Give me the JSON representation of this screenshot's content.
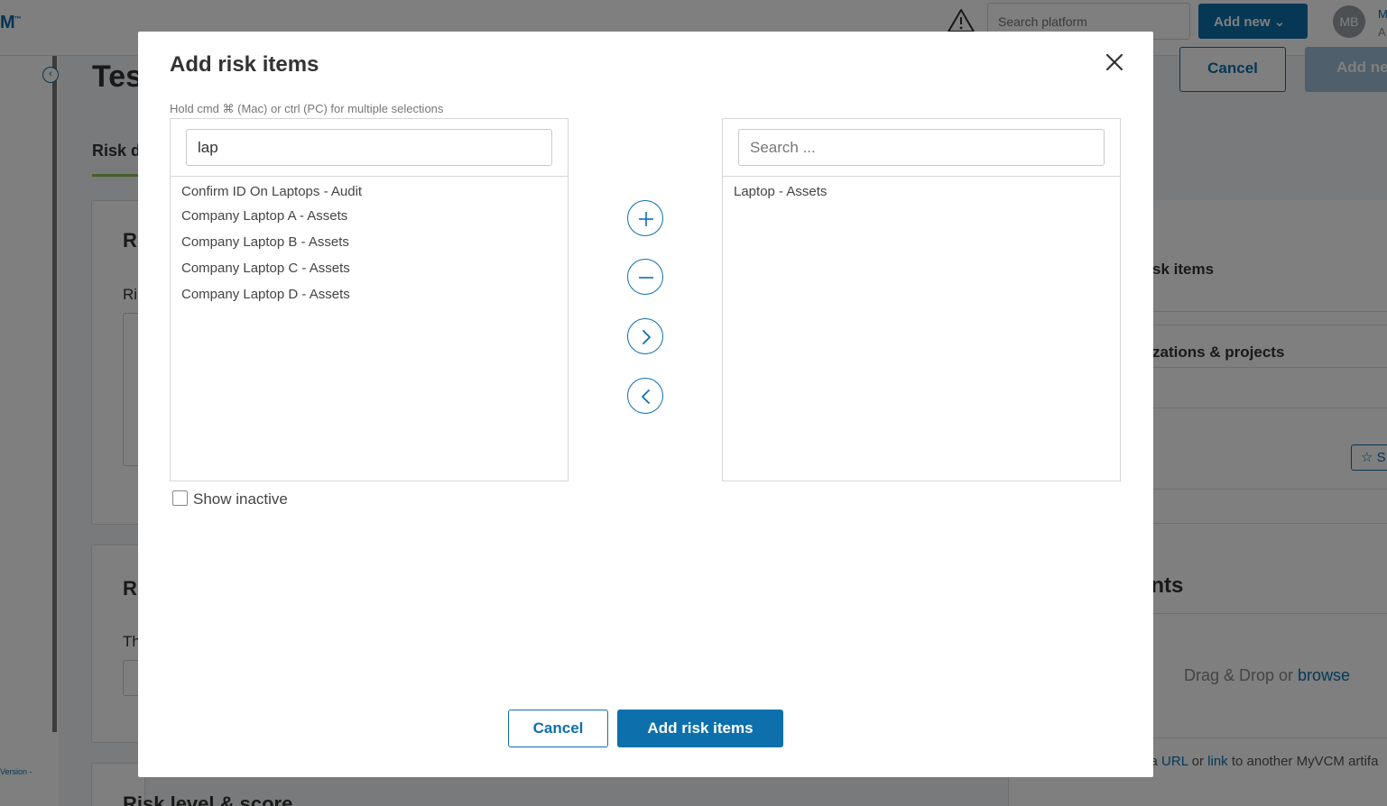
{
  "header": {
    "logo": "M",
    "logo_mark": "™",
    "search_placeholder": "Search platform",
    "add_new_label": "Add new",
    "avatar_initials": "MB",
    "user_initial_1": "M",
    "user_initial_2": "A"
  },
  "sidebar": {
    "version_text": "Version -"
  },
  "page": {
    "title_fragment": "Tes",
    "cancel_label": "Cancel",
    "add_label_fragment": "Add ne",
    "tab_fragment": "Risk d",
    "card_a_heading": "R",
    "card_a_label": "Ri",
    "card_b_heading": "R",
    "card_b_label": "Th",
    "card_c_heading": "Risk level & score",
    "right_panel": {
      "risk_items_fragment": "sk items",
      "orgs_fragment": "zations & projects",
      "attachments_fragment": "ents",
      "drop_text": "Drag & Drop or ",
      "drop_link": "browse",
      "url_prefix": "d a ",
      "url_link": "URL",
      "url_or": " or ",
      "url_link2": "link",
      "url_suffix": " to another MyVCM artifa",
      "star_button_fragment": "S"
    }
  },
  "modal": {
    "title": "Add risk items",
    "hint": "Hold cmd ⌘ (Mac) or ctrl (PC) for multiple selections",
    "left_search_value": "lap",
    "right_search_placeholder": "Search ...",
    "available_items": [
      "Confirm ID On Laptops - Audit",
      "Company Laptop A - Assets",
      "Company Laptop B - Assets",
      "Company Laptop C - Assets",
      "Company Laptop D - Assets"
    ],
    "selected_items": [
      "Laptop - Assets"
    ],
    "show_inactive_label": "Show inactive",
    "show_inactive_checked": false,
    "cancel_label": "Cancel",
    "submit_label": "Add risk items"
  },
  "colors": {
    "accent": "#0d70ad",
    "overlay": "rgba(0,0,0,0.5)",
    "tab_underline": "#8cc152"
  }
}
